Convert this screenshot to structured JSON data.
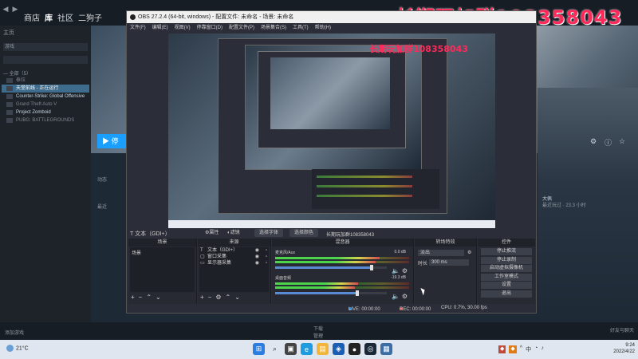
{
  "watermark": "长期玩加群1083580​43",
  "steam": {
    "nav": [
      "商店",
      "库",
      "社区",
      "二狗子"
    ],
    "sidebar": {
      "home": "主页",
      "filter": "游戏",
      "all_label": "— 全部（5）",
      "games": [
        {
          "name": "泰拉",
          "state": "dim"
        },
        {
          "name": "天堂前线 - 正在运行",
          "state": "active"
        },
        {
          "name": "Counter-Strike: Global Offensive",
          "state": "normal"
        },
        {
          "name": "Grand Theft Auto V",
          "state": "dim"
        },
        {
          "name": "Project Zomboid",
          "state": "normal"
        },
        {
          "name": "PUBG: BATTLEGROUNDS",
          "state": "dim"
        }
      ],
      "add_game": "添加游戏"
    },
    "play_button": "▶ 停",
    "main_labels": {
      "activity": "动态",
      "recent": "最近"
    },
    "download_label": "下载",
    "download_sub": "管理",
    "friends_label": "好友与聊天",
    "hero_right": [
      "大佩",
      "最近玩过 · 23.3 小时"
    ]
  },
  "obs": {
    "title": "OBS 27.2.4 (64-bit, windows) - 配置文件: 未命名 - 场景: 未命名",
    "menu": [
      "文件(F)",
      "编辑(E)",
      "视图(V)",
      "停靠窗口(D)",
      "配置文件(P)",
      "场景集合(S)",
      "工具(T)",
      "帮助(H)"
    ],
    "preview_watermark": "长期玩加群108358043",
    "source_bar": {
      "source_name": "文本（GDI+）",
      "properties": "属性",
      "filters": "滤镜",
      "pick_font": "选择字体",
      "pick_color": "选择颜色",
      "text_value": "长期玩加群108358043"
    },
    "docks": {
      "scenes": {
        "title": "场景",
        "items": [
          "场景"
        ]
      },
      "sources": {
        "title": "来源",
        "items": [
          {
            "icon": "T",
            "name": "文本（GDI+）"
          },
          {
            "icon": "▢",
            "name": "窗口采集"
          },
          {
            "icon": "▭",
            "name": "显示器采集"
          }
        ]
      },
      "mixer": {
        "title": "混音器",
        "tracks": [
          {
            "name": "麦克风/Aux",
            "db": "0.0 dB",
            "level": 0.78,
            "volume": 0.85
          },
          {
            "name": "桌面音频",
            "db": "-19.3 dB",
            "level": 0.62,
            "volume": 0.72
          }
        ]
      },
      "transitions": {
        "title": "转场特效",
        "type": "淡出",
        "duration_label": "时长",
        "duration_value": "300 ms"
      },
      "controls": {
        "title": "控件",
        "buttons": [
          "停止推流",
          "停止录制",
          "启动虚拟摄像机",
          "工作室模式",
          "设置",
          "退出"
        ]
      }
    },
    "status": {
      "live": "LIVE: 00:00:00",
      "rec": "REC: 00:00:00",
      "cpu": "CPU: 0.7%, 30.00 fps"
    }
  },
  "taskbar": {
    "weather": "21°C",
    "tray": [
      "^",
      "中",
      "英"
    ],
    "time": "9:24",
    "date": "2022/4/22"
  },
  "colors": {
    "steam_bg": "#1b2838",
    "obs_bg": "#2b2e38",
    "watermark": "#ff2a5a",
    "accent": "#1a9fff"
  }
}
